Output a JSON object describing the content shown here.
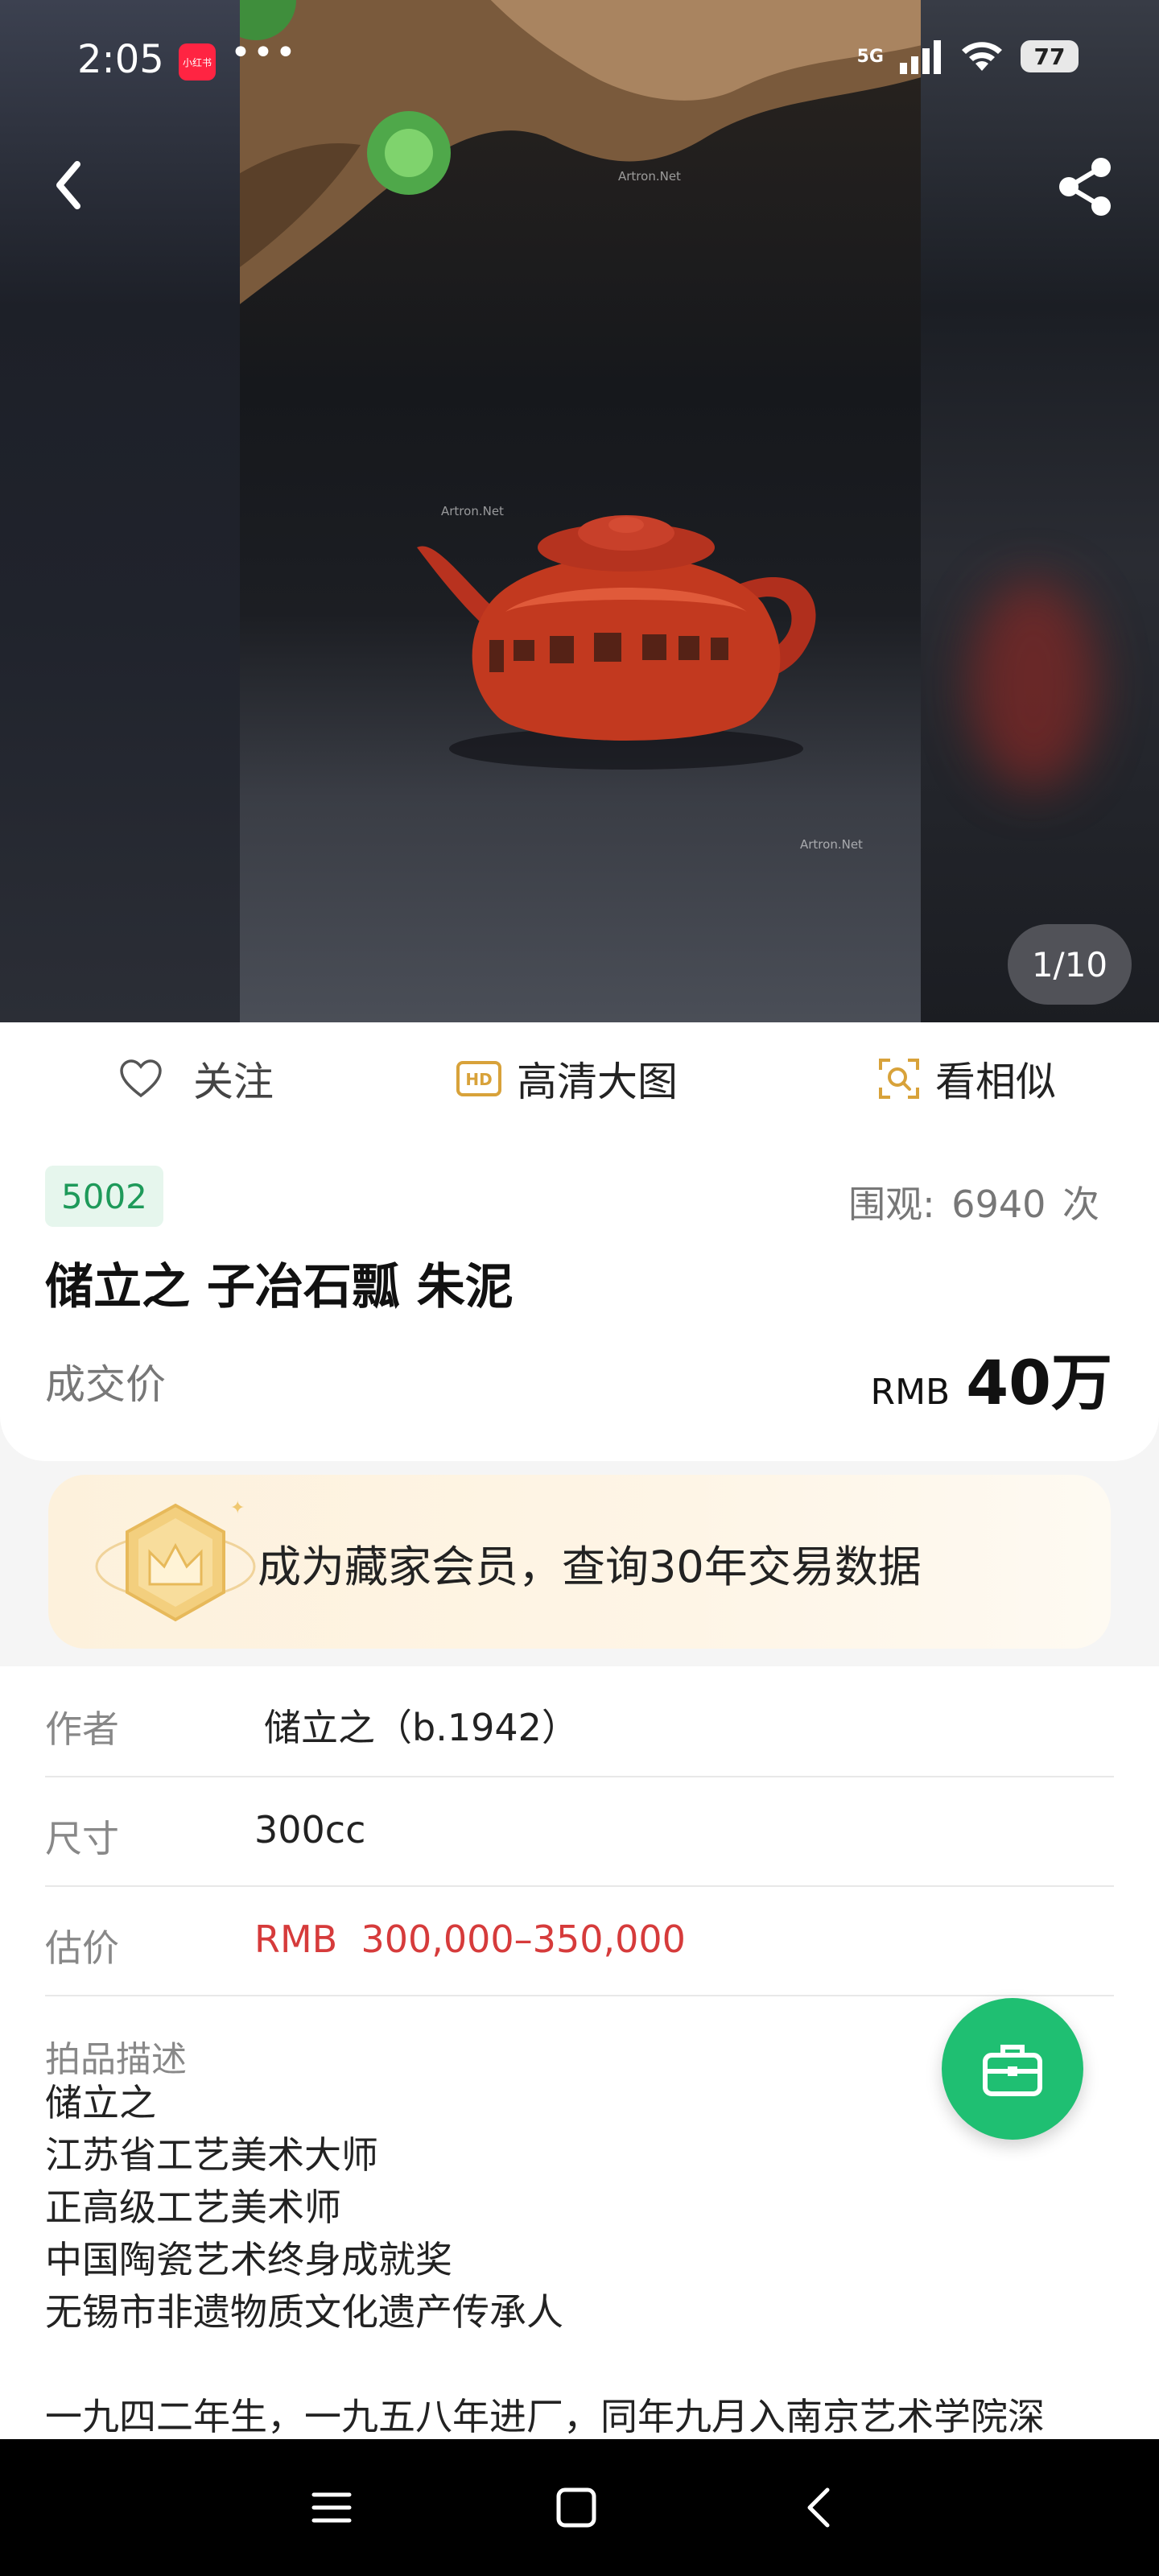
{
  "status_bar": {
    "time": "2:05",
    "app_icon_label": "小红书",
    "more": "•••",
    "network": "5G",
    "battery": "77"
  },
  "hero": {
    "watermark": "Artron.Net",
    "page_counter": "1/10"
  },
  "actions": {
    "follow_label": "关注",
    "hd_badge": "HD",
    "hd_label": "高清大图",
    "similar_label": "看相似"
  },
  "lot": {
    "number": "5002",
    "views_label": "围观:",
    "views_count": "6940",
    "views_unit": "次",
    "title": "储立之 子冶石瓢  朱泥",
    "deal_label": "成交价",
    "currency": "RMB",
    "price": "40万"
  },
  "member_banner": {
    "text": "成为藏家会员，查询30年交易数据"
  },
  "details": {
    "author_label": "作者",
    "author_value": "储立之（b.1942）",
    "size_label": "尺寸",
    "size_value": "300cc",
    "estimate_label": "估价",
    "estimate_value": "RMB  300,000–350,000",
    "description_label": "拍品描述",
    "description_lines": [
      "储立之",
      "江苏省工艺美术大师",
      "正高级工艺美术师",
      "中国陶瓷艺术终身成就奖",
      "无锡市非遗物质文化遗产传承人"
    ],
    "bio_line": "一九四二年生，一九五八年进厂，同年九月入南京艺术学院深"
  },
  "colors": {
    "accent_green": "#1fbf72",
    "estimate_red": "#d63b3b",
    "badge_green": "#1e9a5a"
  }
}
